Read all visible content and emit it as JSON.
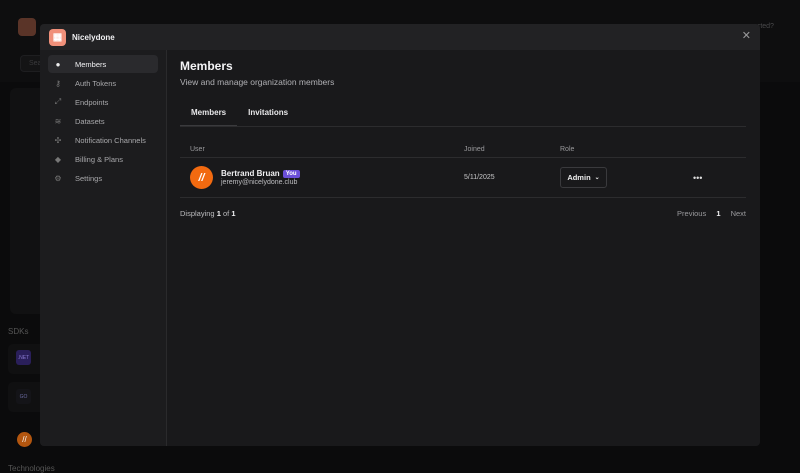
{
  "background": {
    "help_text": "rted?",
    "search_placeholder": "Sea",
    "sdks_label": "SDKs",
    "technologies_label": "Technologies"
  },
  "modal": {
    "org_name": "Nicelydone",
    "sidebar": {
      "items": [
        {
          "label": "Members",
          "icon": "user-icon",
          "active": true
        },
        {
          "label": "Auth Tokens",
          "icon": "key-icon"
        },
        {
          "label": "Endpoints",
          "icon": "link-icon"
        },
        {
          "label": "Datasets",
          "icon": "layers-icon"
        },
        {
          "label": "Notification Channels",
          "icon": "bell-icon"
        },
        {
          "label": "Billing & Plans",
          "icon": "diamond-icon"
        },
        {
          "label": "Settings",
          "icon": "gear-icon"
        }
      ]
    },
    "main": {
      "title": "Members",
      "subtitle": "View and manage organization members",
      "tabs": [
        {
          "label": "Members",
          "active": true
        },
        {
          "label": "Invitations"
        }
      ],
      "columns": {
        "user": "User",
        "joined": "Joined",
        "role": "Role"
      },
      "rows": [
        {
          "name": "Bertrand Bruan",
          "badge": "You",
          "email": "jeremy@nicelydone.club",
          "joined": "5/11/2025",
          "role": "Admin"
        }
      ],
      "footer": {
        "displaying": "Displaying",
        "from": "1",
        "of": "of",
        "total": "1",
        "previous": "Previous",
        "page": "1",
        "next": "Next"
      }
    }
  },
  "colors": {
    "accent_badge": "#6b4fd8",
    "avatar": "#f26a10",
    "org_logo": "#f0907a"
  }
}
